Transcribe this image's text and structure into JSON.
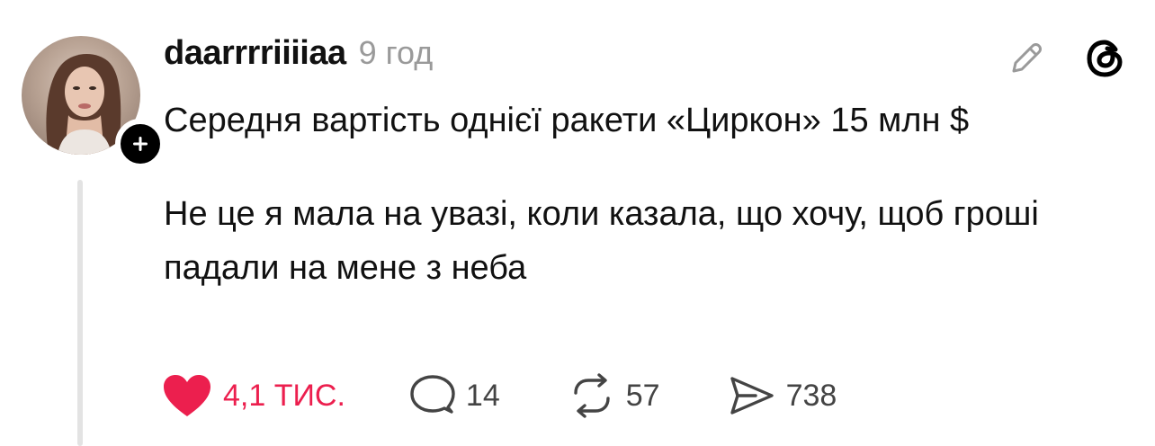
{
  "post": {
    "username": "daarrrriiiiaa",
    "timestamp": "9 год",
    "paragraph_1": "Середня вартість однієї ракети «Циркон» 15 млн $",
    "paragraph_2": "Не це я мала на увазі, коли казала, що хочу, щоб гроші падали на мене з неба"
  },
  "actions": {
    "likes": "4,1 ТИС.",
    "replies": "14",
    "reposts": "57",
    "shares": "738"
  },
  "icons": {
    "edit": "pencil-icon",
    "app": "threads-logo-icon",
    "like": "heart-filled-icon",
    "reply": "speech-bubble-icon",
    "repost": "repost-arrows-icon",
    "share": "send-icon",
    "follow": "plus-icon"
  },
  "colors": {
    "like_active": "#ec1f4e",
    "secondary_text": "#9a9a9a",
    "thread_line": "#e3e3e3"
  }
}
